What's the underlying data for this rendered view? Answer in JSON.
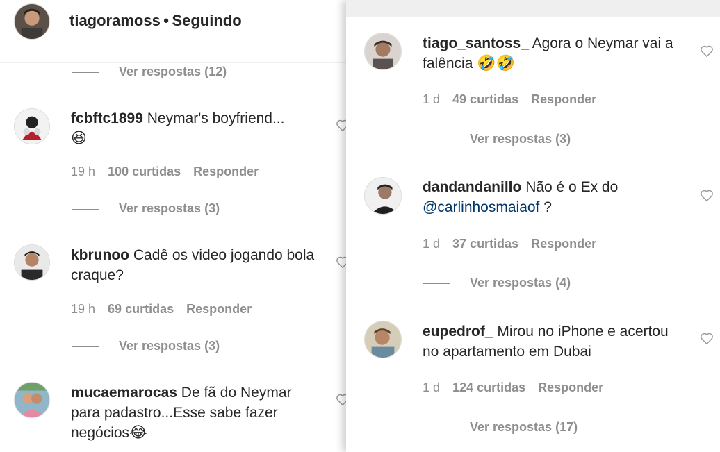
{
  "left": {
    "header": {
      "username": "tiagoramoss",
      "separator": "•",
      "follow_status": "Seguindo"
    },
    "top_replies": "Ver respostas (12)",
    "comments": [
      {
        "username": "fcbftc1899",
        "text": "Neymar's boyfriend...",
        "emoji": "😆",
        "time": "19 h",
        "likes": "100 curtidas",
        "reply": "Responder",
        "replies": "Ver respostas (3)"
      },
      {
        "username": "kbrunoo",
        "text": "Cadê os video jogando bola craque?",
        "time": "19 h",
        "likes": "69 curtidas",
        "reply": "Responder",
        "replies": "Ver respostas (3)"
      },
      {
        "username": "mucaemarocas",
        "text": "De fã do Neymar para padastro...Esse sabe fazer negócios",
        "emoji": "😂"
      }
    ]
  },
  "right": {
    "comments": [
      {
        "username": "tiago_santoss_",
        "text": "Agora o Neymar vai a falência",
        "emoji": "🤣🤣",
        "time": "1 d",
        "likes": "49 curtidas",
        "reply": "Responder",
        "replies": "Ver respostas (3)"
      },
      {
        "username": "dandandanillo",
        "text": "Não é o Ex do",
        "mention": "@carlinhosmaiaof",
        "text_after": " ?",
        "time": "1 d",
        "likes": "37 curtidas",
        "reply": "Responder",
        "replies": "Ver respostas (4)"
      },
      {
        "username": "eupedrof_",
        "text": "Mirou no iPhone e acertou no apartamento em Dubai",
        "time": "1 d",
        "likes": "124 curtidas",
        "reply": "Responder",
        "replies": "Ver respostas (17)"
      }
    ]
  },
  "icons": {
    "like": "heart-outline-icon"
  },
  "colors": {
    "text": "#262626",
    "secondary": "#8e8e8e",
    "mention": "#00376b"
  }
}
